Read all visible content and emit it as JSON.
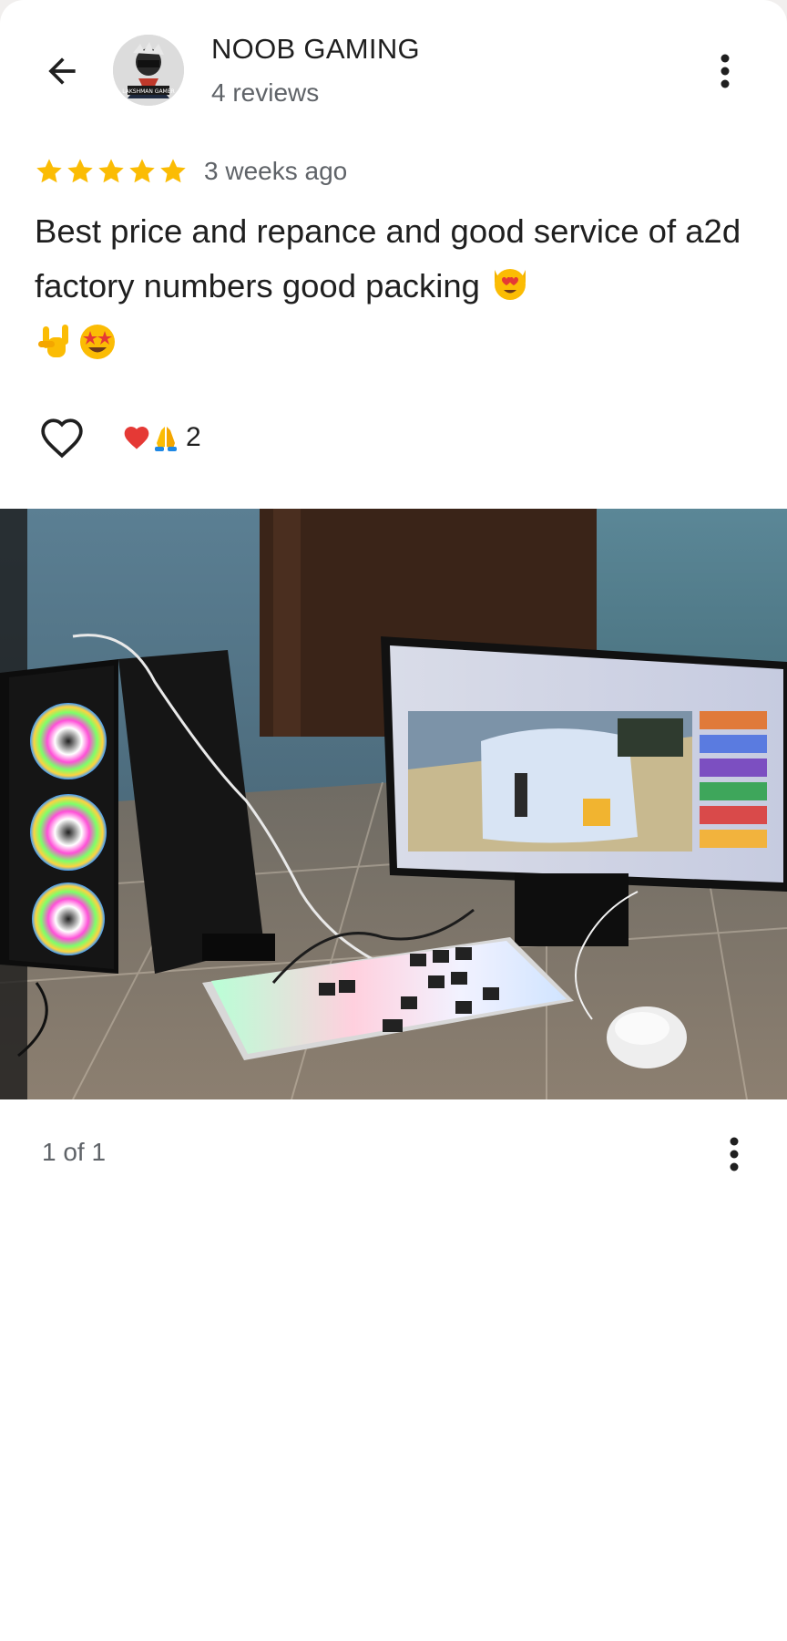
{
  "header": {
    "back_icon": "arrow-back-icon",
    "author_name": "NOOB GAMING",
    "review_count": "4 reviews",
    "avatar_label": "LAKSHMAN GAMER",
    "menu_icon": "more-vert-icon"
  },
  "review": {
    "rating": 5,
    "rating_max": 5,
    "star_color": "#fbbc04",
    "time_ago": "3 weeks ago",
    "text": "Best price and repance and good service of a2d factory numbers good packing",
    "text_emojis": [
      "smiling-cat-heart-eyes-emoji",
      "love-you-gesture-emoji",
      "star-struck-emoji"
    ]
  },
  "reactions": {
    "like_icon": "heart-outline-icon",
    "summary_icons": [
      "red-heart-emoji",
      "folded-hands-emoji"
    ],
    "count": "2"
  },
  "photo": {
    "description_icon": "review-photo",
    "counter": "1 of 1",
    "menu_icon": "more-vert-icon"
  }
}
